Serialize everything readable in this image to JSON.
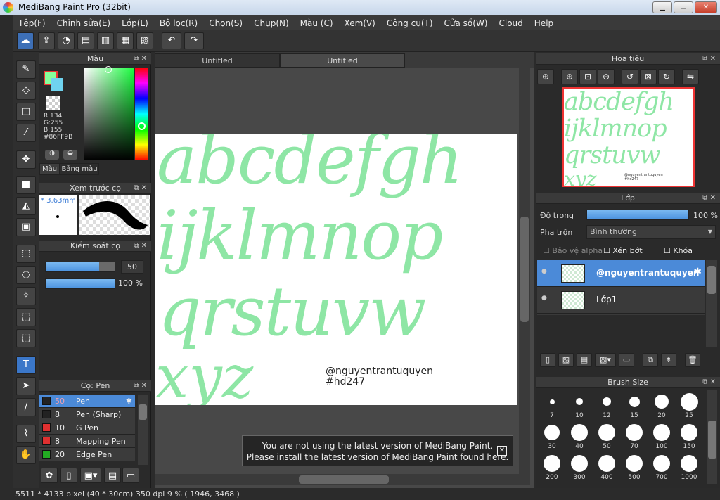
{
  "window": {
    "title": "MediBang Paint Pro (32bit)",
    "minimize": "▁",
    "maximize": "❐",
    "close": "✕"
  },
  "menu": [
    "Tệp(F)",
    "Chỉnh sửa(E)",
    "Lớp(L)",
    "Bộ lọc(R)",
    "Chọn(S)",
    "Chụp(N)",
    "Màu (C)",
    "Xem(V)",
    "Công cụ(T)",
    "Cửa sổ(W)",
    "Cloud",
    "Help"
  ],
  "toolbar": {
    "undo": "↶",
    "redo": "↷"
  },
  "color_panel": {
    "title": "Màu",
    "rgb": [
      "R:134",
      "G:255",
      "B:155"
    ],
    "hex": "#86FF9B",
    "tab_color": "Màu",
    "tab_palette": "Bảng màu",
    "fg_color": "#86FF9B",
    "bg_color": "#6fd3ef"
  },
  "preview_panel": {
    "title": "Xem trước cọ",
    "size": "* 3.63mm"
  },
  "control_panel": {
    "title": "Kiểm soát cọ",
    "size_value": "50",
    "size_fraction": 0.78,
    "opacity_value": "100 %",
    "opacity_fraction": 1.0
  },
  "brush_panel": {
    "title": "Cọ: Pen",
    "brushes": [
      {
        "size": "50",
        "name": "Pen",
        "color": "#222222",
        "selected": true
      },
      {
        "size": "8",
        "name": "Pen (Sharp)",
        "color": "#222222",
        "selected": false
      },
      {
        "size": "10",
        "name": "G Pen",
        "color": "#e03030",
        "selected": false
      },
      {
        "size": "8",
        "name": "Mapping Pen",
        "color": "#e03030",
        "selected": false
      },
      {
        "size": "20",
        "name": "Edge Pen",
        "color": "#22aa22",
        "selected": false
      }
    ]
  },
  "canvas": {
    "tabs": [
      "Untitled",
      "Untitled"
    ],
    "lines": [
      "abcdefgh",
      "ijklmnop",
      "qrstuvw",
      "xyz"
    ],
    "watermark": [
      "@nguyentrantuquyen",
      "#hd247"
    ],
    "ink_color": "#8ee6a5"
  },
  "notification": {
    "line1": "You are not using the latest version of MediBang Paint.",
    "line2": "Please install the latest version of MediBang Paint found here.",
    "close": "✕"
  },
  "navigator": {
    "title": "Hoa tiêu",
    "lines": [
      "abcdefgh",
      "ijklmnop",
      "qrstuvw",
      "xyz"
    ],
    "watermark": "@nguyentrantuquyen\n#hd247"
  },
  "layer_panel": {
    "title": "Lớp",
    "opacity_label": "Độ trong",
    "opacity_value": "100 %",
    "opacity_fraction": 1.0,
    "blend_label": "Pha trộn",
    "blend_value": "Bình thường",
    "protect_alpha": "Bảo vệ alpha",
    "clipping": "Xén bớt",
    "lock": "Khóa",
    "layers": [
      {
        "name": "@nguyentrantuquyen",
        "selected": true
      },
      {
        "name": "Lớp1",
        "selected": false
      }
    ]
  },
  "brush_size_panel": {
    "title": "Brush Size",
    "sizes": [
      "7",
      "10",
      "12",
      "15",
      "20",
      "25",
      "30",
      "40",
      "50",
      "70",
      "100",
      "150",
      "200",
      "300",
      "400",
      "500",
      "700",
      "1000"
    ]
  },
  "status": {
    "text": "5511 * 4133 pixel   (40 * 30cm)   350 dpi   9 %   ( 1946, 3468 )"
  }
}
